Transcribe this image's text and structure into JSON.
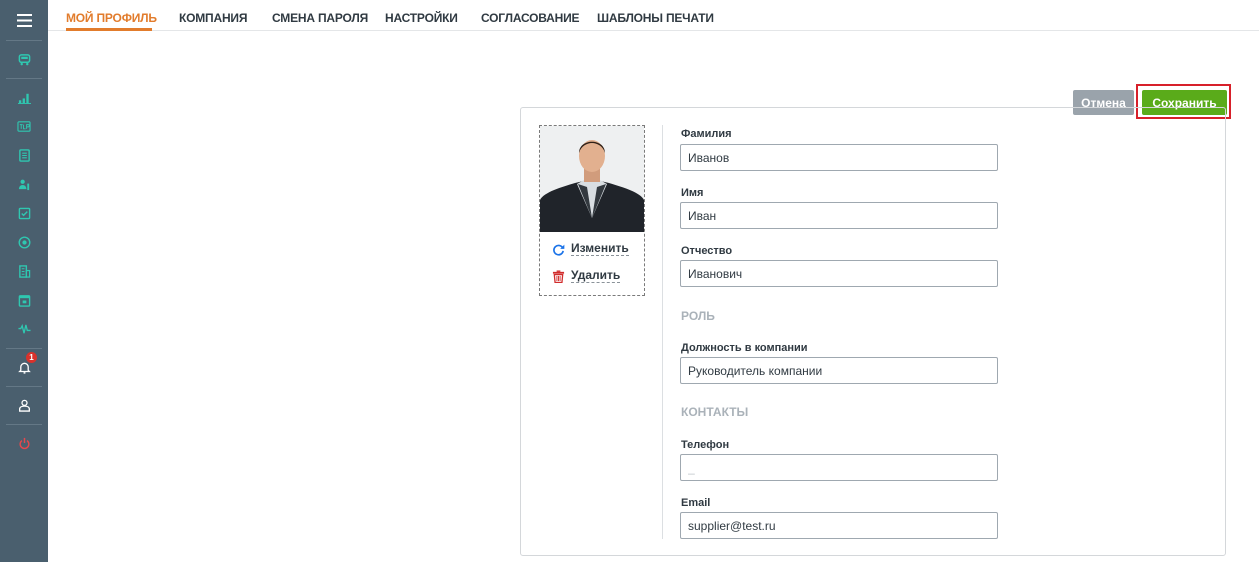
{
  "tabs": [
    "МОЙ ПРОФИЛЬ",
    "КОМПАНИЯ",
    "СМЕНА ПАРОЛЯ",
    "НАСТРОЙКИ",
    "СОГЛАСОВАНИЕ",
    "ШАБЛОНЫ ПЕЧАТИ"
  ],
  "sidebar": {
    "notification_count": "1",
    "icons": [
      "menu-icon",
      "truck-icon",
      "bar-chart-icon",
      "tlp-icon",
      "document-icon",
      "people-icon",
      "checklist-icon",
      "target-icon",
      "building-icon",
      "calendar-icon",
      "pulse-icon",
      "bell-icon",
      "user-icon",
      "power-icon"
    ]
  },
  "actions": {
    "cancel": "Отмена",
    "save": "Сохранить"
  },
  "photo": {
    "change": "Изменить",
    "delete": "Удалить"
  },
  "form": {
    "last_name_label": "Фамилия",
    "last_name": "Иванов",
    "first_name_label": "Имя",
    "first_name": "Иван",
    "patronymic_label": "Отчество",
    "patronymic": "Иванович",
    "role_section": "РОЛЬ",
    "position_label": "Должность в компании",
    "position": "Руководитель компании",
    "contacts_section": "КОНТАКТЫ",
    "phone_label": "Телефон",
    "phone_placeholder": "_",
    "email_label": "Email",
    "email": "supplier@test.ru"
  },
  "colors": {
    "sidebar": "#4a5f6e",
    "sidebar_icon": "#2fc7b0",
    "accent": "#e27c2c",
    "save": "#5aab1a",
    "cancel": "#9aa3ab",
    "highlight": "#d7202a"
  }
}
